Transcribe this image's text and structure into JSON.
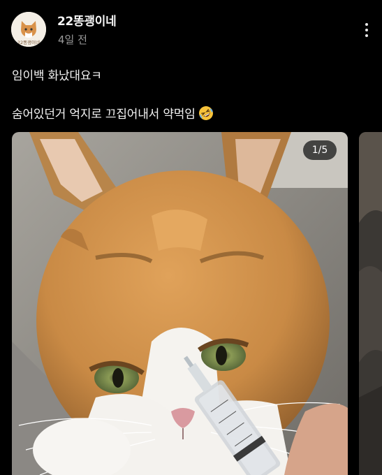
{
  "author": {
    "name": "22똥괭이네",
    "avatar_label": "22똥괭이네",
    "avatar_icon": "cat-avatar-icon"
  },
  "post": {
    "time": "4일 전",
    "text_line_1": "임이백 화났대요ㅋ",
    "text_line_2": "숨어있던거 억지로 끄집어내서 약먹임",
    "emoji": "rolling-on-floor-laughing-icon"
  },
  "media": {
    "page_indicator": "1/5",
    "current_page": 1,
    "total_pages": 5,
    "main_image_subject": "cat-syringe-photo"
  },
  "colors": {
    "background": "#000000",
    "text": "#f2f2f2",
    "secondary_text": "#9a9a9a",
    "indicator_bg": "#1e1e1e"
  }
}
